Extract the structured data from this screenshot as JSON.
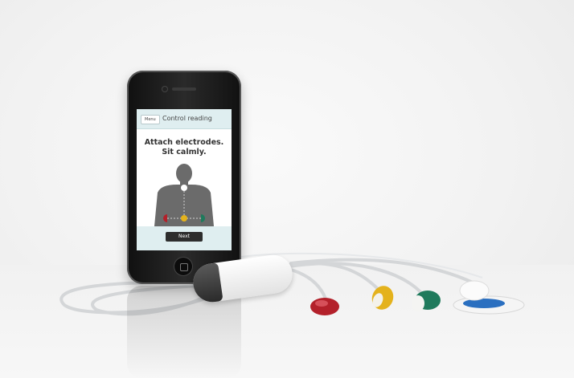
{
  "app": {
    "menu_label": "Menu",
    "title": "Control reading",
    "instruction_line1": "Attach electrodes.",
    "instruction_line2": "Sit calmly.",
    "next_label": "Next"
  },
  "colors": {
    "screen_accent": "#dfeef0",
    "electrode_red": "#b3202a",
    "electrode_yellow": "#e4b21c",
    "electrode_green": "#1f7a5c",
    "electrode_blue": "#2a6fc0",
    "body_silhouette": "#6b6b6b"
  }
}
